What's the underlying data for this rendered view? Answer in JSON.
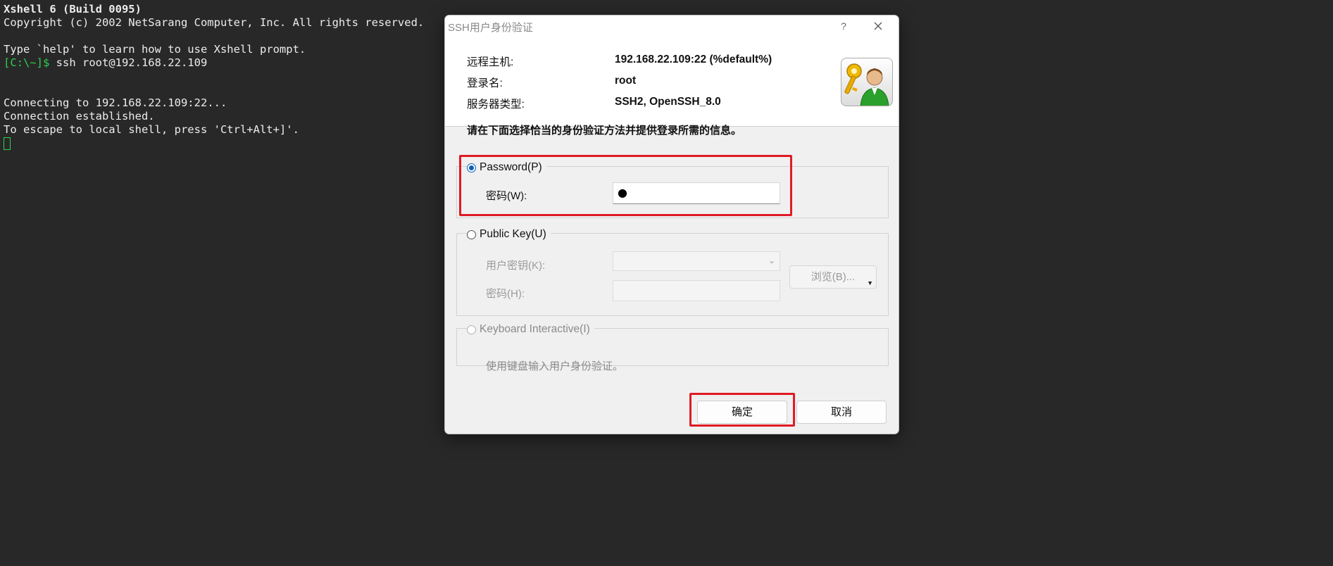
{
  "terminal": {
    "lines": [
      "Xshell 6 (Build 0095)",
      "Copyright (c) 2002 NetSarang Computer, Inc. All rights reserved.",
      "",
      "Type `help' to learn how to use Xshell prompt.",
      "",
      "",
      "",
      "Connecting to 192.168.22.109:22...",
      "Connection established.",
      "To escape to local shell, press 'Ctrl+Alt+]'."
    ],
    "prompt": "[C:\\~]$",
    "command": " ssh root@192.168.22.109"
  },
  "dialog": {
    "title": "SSH用户身份验证",
    "help_label": "?",
    "remote_host_label": "远程主机:",
    "remote_host_value": "192.168.22.109:22 (%default%)",
    "login_label": "登录名:",
    "login_value": "root",
    "server_type_label": "服务器类型:",
    "server_type_value": "SSH2, OpenSSH_8.0",
    "instruction": "请在下面选择恰当的身份验证方法并提供登录所需的信息。",
    "password_option": "Password(P)",
    "password_field_label": "密码(W):",
    "password_value": "●",
    "public_key_option": "Public Key(U)",
    "user_key_label": "用户密钥(K):",
    "browse_label": "浏览(B)...",
    "passphrase_label": "密码(H):",
    "keyboard_option": "Keyboard Interactive(I)",
    "keyboard_hint": "使用键盘输入用户身份验证。",
    "ok_label": "确定",
    "cancel_label": "取消"
  },
  "colors": {
    "terminal_bg": "#282828",
    "prompt": "#2fd04f",
    "highlight": "#e01b24",
    "radio_accent": "#0c5fba"
  },
  "icons": {
    "close": "close-icon",
    "key_user": "key-user-icon",
    "dropdown": "chevron-down-icon"
  }
}
